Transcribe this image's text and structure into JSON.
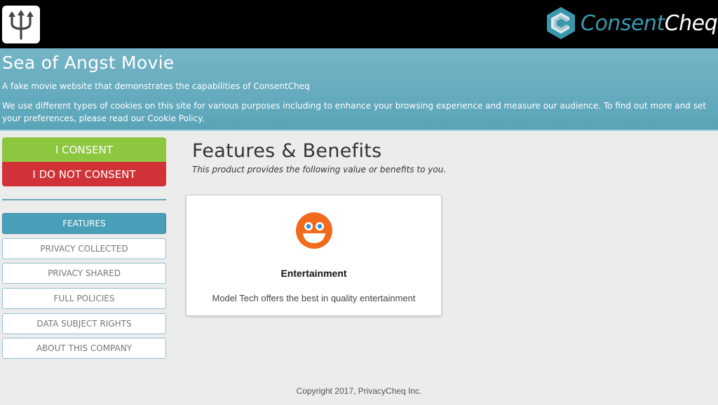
{
  "header": {
    "logo_icon": "trident-icon",
    "brand": {
      "part1": "Consent",
      "part2": "Cheq",
      "icon": "consentcheq-hexagon-logo"
    }
  },
  "hero": {
    "title": "Sea of Angst Movie",
    "subtitle": "A fake movie website that demonstrates the capabilities of ConsentCheq",
    "cookie_notice": "We use different types of cookies on this site for various purposes including to enhance your browsing experience and measure our audience. To find out more and set your preferences, please read our Cookie Policy."
  },
  "consent": {
    "accept_label": "I CONSENT",
    "reject_label": "I DO NOT CONSENT",
    "accept_color": "#8dc63f",
    "reject_color": "#d03238"
  },
  "nav": {
    "items": [
      {
        "label": "FEATURES",
        "active": true
      },
      {
        "label": "PRIVACY COLLECTED",
        "active": false
      },
      {
        "label": "PRIVACY SHARED",
        "active": false
      },
      {
        "label": "FULL POLICIES",
        "active": false
      },
      {
        "label": "DATA SUBJECT RIGHTS",
        "active": false
      },
      {
        "label": "ABOUT THIS COMPANY",
        "active": false
      }
    ]
  },
  "main": {
    "title": "Features & Benefits",
    "intro": "This product provides the following value or benefits to you.",
    "cards": [
      {
        "icon": "grinning-face-icon",
        "title": "Entertainment",
        "description": "Model Tech offers the best in quality entertainment"
      }
    ]
  },
  "footer": {
    "copyright": "Copyright 2017, PrivacyCheq Inc."
  }
}
